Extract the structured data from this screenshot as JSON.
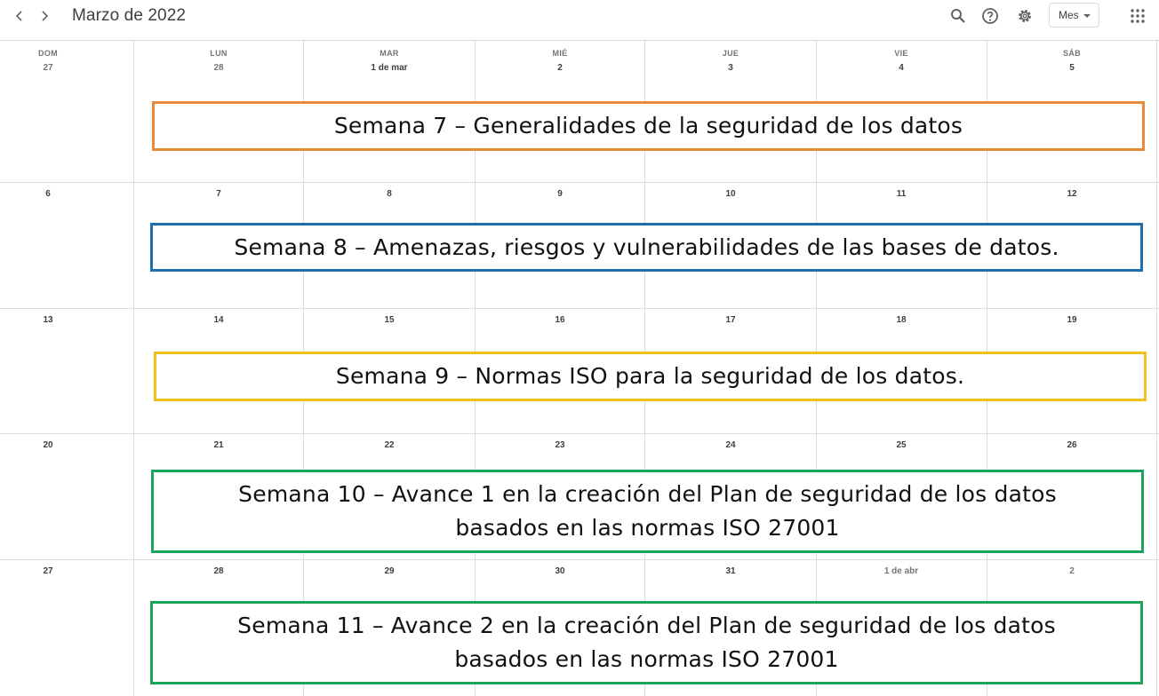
{
  "header": {
    "month_title": "Marzo de 2022",
    "view_selector": "Mes",
    "icons": [
      "chevron-left-icon",
      "chevron-right-icon",
      "search-icon",
      "help-icon",
      "gear-icon",
      "apps-grid-icon"
    ]
  },
  "calendar": {
    "weekdays": [
      "DOM",
      "LUN",
      "MAR",
      "MIÉ",
      "JUE",
      "VIE",
      "SÁB"
    ],
    "weeks": [
      {
        "days": [
          "27",
          "28",
          "1 de mar",
          "2",
          "3",
          "4",
          "5"
        ]
      },
      {
        "days": [
          "6",
          "7",
          "8",
          "9",
          "10",
          "11",
          "12"
        ]
      },
      {
        "days": [
          "13",
          "14",
          "15",
          "16",
          "17",
          "18",
          "19"
        ]
      },
      {
        "days": [
          "20",
          "21",
          "22",
          "23",
          "24",
          "25",
          "26"
        ]
      },
      {
        "days": [
          "27",
          "28",
          "29",
          "30",
          "31",
          "1 de abr",
          "2"
        ]
      }
    ]
  },
  "banners": {
    "week7": "Semana 7 – Generalidades de la seguridad de los datos",
    "week8": "Semana 8 – Amenazas, riesgos y vulnerabilidades de las bases de datos.",
    "week9": "Semana 9 – Normas ISO para la seguridad de los datos.",
    "week10": "Semana 10 – Avance 1 en la creación del Plan de seguridad de los datos basados en las normas ISO 27001",
    "week11": "Semana 11 – Avance 2 en la creación del Plan de seguridad de los datos basados en las normas ISO 27001"
  },
  "colors": {
    "week7_border": "#e88a3a",
    "week8_border": "#1f6fae",
    "week9_border": "#f1c21b",
    "week10_border": "#1ea35a",
    "week11_border": "#1ea35a",
    "grid_line": "#dadce0"
  }
}
